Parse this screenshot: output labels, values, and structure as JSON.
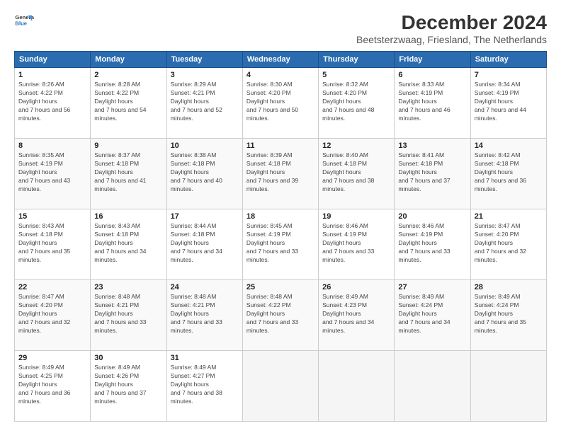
{
  "logo": {
    "line1": "General",
    "line2": "Blue"
  },
  "title": "December 2024",
  "subtitle": "Beetsterzwaag, Friesland, The Netherlands",
  "days_header": [
    "Sunday",
    "Monday",
    "Tuesday",
    "Wednesday",
    "Thursday",
    "Friday",
    "Saturday"
  ],
  "weeks": [
    [
      {
        "num": "1",
        "sr": "8:26 AM",
        "ss": "4:22 PM",
        "dl": "7 hours and 56 minutes."
      },
      {
        "num": "2",
        "sr": "8:28 AM",
        "ss": "4:22 PM",
        "dl": "7 hours and 54 minutes."
      },
      {
        "num": "3",
        "sr": "8:29 AM",
        "ss": "4:21 PM",
        "dl": "7 hours and 52 minutes."
      },
      {
        "num": "4",
        "sr": "8:30 AM",
        "ss": "4:20 PM",
        "dl": "7 hours and 50 minutes."
      },
      {
        "num": "5",
        "sr": "8:32 AM",
        "ss": "4:20 PM",
        "dl": "7 hours and 48 minutes."
      },
      {
        "num": "6",
        "sr": "8:33 AM",
        "ss": "4:19 PM",
        "dl": "7 hours and 46 minutes."
      },
      {
        "num": "7",
        "sr": "8:34 AM",
        "ss": "4:19 PM",
        "dl": "7 hours and 44 minutes."
      }
    ],
    [
      {
        "num": "8",
        "sr": "8:35 AM",
        "ss": "4:19 PM",
        "dl": "7 hours and 43 minutes."
      },
      {
        "num": "9",
        "sr": "8:37 AM",
        "ss": "4:18 PM",
        "dl": "7 hours and 41 minutes."
      },
      {
        "num": "10",
        "sr": "8:38 AM",
        "ss": "4:18 PM",
        "dl": "7 hours and 40 minutes."
      },
      {
        "num": "11",
        "sr": "8:39 AM",
        "ss": "4:18 PM",
        "dl": "7 hours and 39 minutes."
      },
      {
        "num": "12",
        "sr": "8:40 AM",
        "ss": "4:18 PM",
        "dl": "7 hours and 38 minutes."
      },
      {
        "num": "13",
        "sr": "8:41 AM",
        "ss": "4:18 PM",
        "dl": "7 hours and 37 minutes."
      },
      {
        "num": "14",
        "sr": "8:42 AM",
        "ss": "4:18 PM",
        "dl": "7 hours and 36 minutes."
      }
    ],
    [
      {
        "num": "15",
        "sr": "8:43 AM",
        "ss": "4:18 PM",
        "dl": "7 hours and 35 minutes."
      },
      {
        "num": "16",
        "sr": "8:43 AM",
        "ss": "4:18 PM",
        "dl": "7 hours and 34 minutes."
      },
      {
        "num": "17",
        "sr": "8:44 AM",
        "ss": "4:18 PM",
        "dl": "7 hours and 34 minutes."
      },
      {
        "num": "18",
        "sr": "8:45 AM",
        "ss": "4:19 PM",
        "dl": "7 hours and 33 minutes."
      },
      {
        "num": "19",
        "sr": "8:46 AM",
        "ss": "4:19 PM",
        "dl": "7 hours and 33 minutes."
      },
      {
        "num": "20",
        "sr": "8:46 AM",
        "ss": "4:19 PM",
        "dl": "7 hours and 33 minutes."
      },
      {
        "num": "21",
        "sr": "8:47 AM",
        "ss": "4:20 PM",
        "dl": "7 hours and 32 minutes."
      }
    ],
    [
      {
        "num": "22",
        "sr": "8:47 AM",
        "ss": "4:20 PM",
        "dl": "7 hours and 32 minutes."
      },
      {
        "num": "23",
        "sr": "8:48 AM",
        "ss": "4:21 PM",
        "dl": "7 hours and 33 minutes."
      },
      {
        "num": "24",
        "sr": "8:48 AM",
        "ss": "4:21 PM",
        "dl": "7 hours and 33 minutes."
      },
      {
        "num": "25",
        "sr": "8:48 AM",
        "ss": "4:22 PM",
        "dl": "7 hours and 33 minutes."
      },
      {
        "num": "26",
        "sr": "8:49 AM",
        "ss": "4:23 PM",
        "dl": "7 hours and 34 minutes."
      },
      {
        "num": "27",
        "sr": "8:49 AM",
        "ss": "4:24 PM",
        "dl": "7 hours and 34 minutes."
      },
      {
        "num": "28",
        "sr": "8:49 AM",
        "ss": "4:24 PM",
        "dl": "7 hours and 35 minutes."
      }
    ],
    [
      {
        "num": "29",
        "sr": "8:49 AM",
        "ss": "4:25 PM",
        "dl": "7 hours and 36 minutes."
      },
      {
        "num": "30",
        "sr": "8:49 AM",
        "ss": "4:26 PM",
        "dl": "7 hours and 37 minutes."
      },
      {
        "num": "31",
        "sr": "8:49 AM",
        "ss": "4:27 PM",
        "dl": "7 hours and 38 minutes."
      },
      null,
      null,
      null,
      null
    ]
  ],
  "labels": {
    "sunrise": "Sunrise:",
    "sunset": "Sunset:",
    "daylight": "Daylight:"
  }
}
